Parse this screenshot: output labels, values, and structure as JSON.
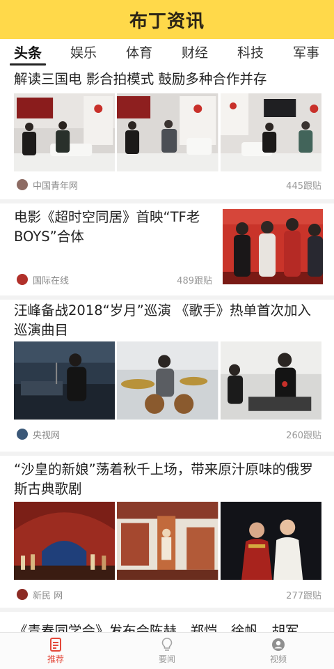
{
  "header": {
    "title": "布丁资讯"
  },
  "tabs": [
    {
      "label": "头条"
    },
    {
      "label": "娱乐"
    },
    {
      "label": "体育"
    },
    {
      "label": "财经"
    },
    {
      "label": "科技"
    },
    {
      "label": "军事"
    }
  ],
  "articles": [
    {
      "title": "解读三国电 影合拍模式 鼓励多种合作并存",
      "source": "中国青年网",
      "comments": "445跟贴",
      "images": [
        "press-conference-photo-1",
        "press-conference-photo-2",
        "press-conference-photo-3"
      ]
    },
    {
      "title": "电影《超时空同居》首映“TF老BOYS”合体",
      "source": "国际在线",
      "comments": "489跟贴",
      "images": [
        "movie-premiere-photo"
      ]
    },
    {
      "title": "汪峰备战2018“岁月”巡演 《歌手》热单首次加入巡演曲目",
      "source": "央视网",
      "comments": "260跟贴",
      "images": [
        "rehearsal-photo-1",
        "rehearsal-photo-2",
        "rehearsal-photo-3"
      ]
    },
    {
      "title": "“沙皇的新娘”荡着秋千上场，带来原汁原味的俄罗斯古典歌剧",
      "source": "新民 网",
      "comments": "277跟贴",
      "images": [
        "opera-stage-photo-1",
        "opera-stage-photo-2",
        "opera-stage-photo-3"
      ]
    },
    {
      "title": "《青春同学会》发布会陈赫、郑恺、徐帆、胡军"
    }
  ],
  "bottom_nav": [
    {
      "label": "推荐",
      "icon": "document-icon",
      "active": true
    },
    {
      "label": "要闻",
      "icon": "lightbulb-icon",
      "active": false
    },
    {
      "label": "视频",
      "icon": "user-circle-icon",
      "active": false
    }
  ],
  "colors": {
    "header_bg": "#ffd94a",
    "active_nav": "#e3483a"
  }
}
